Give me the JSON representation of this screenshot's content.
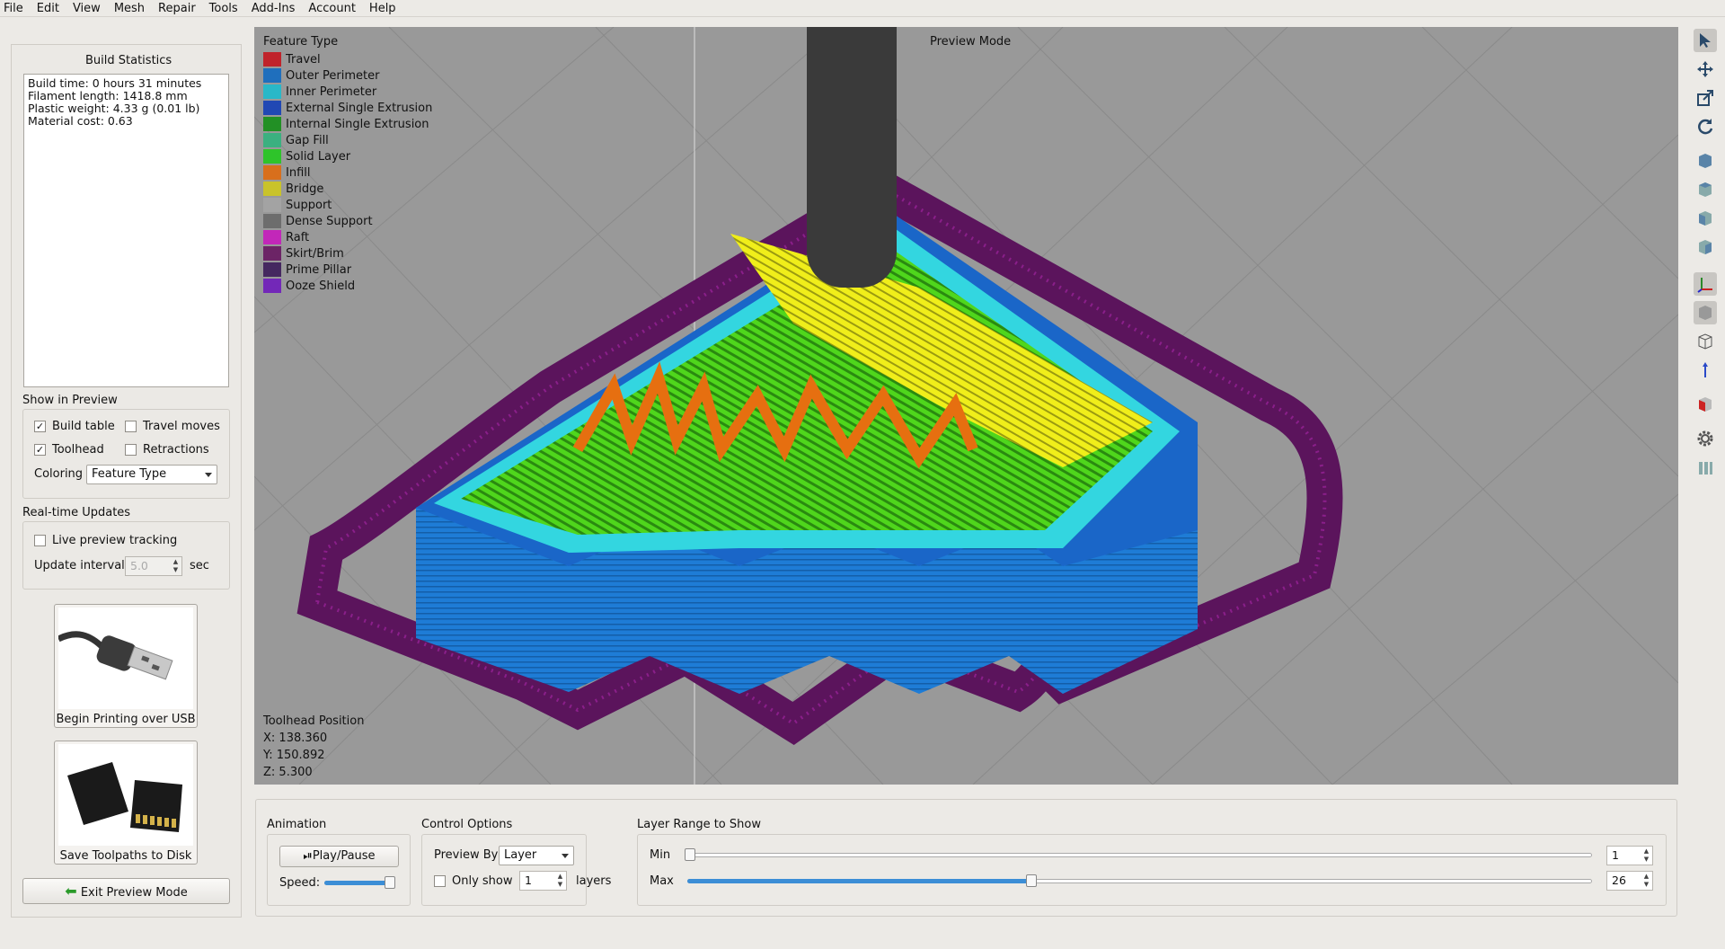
{
  "menu": [
    "File",
    "Edit",
    "View",
    "Mesh",
    "Repair",
    "Tools",
    "Add-Ins",
    "Account",
    "Help"
  ],
  "left": {
    "stats_title": "Build Statistics",
    "stats_lines": [
      "Build time: 0 hours 31 minutes",
      "Filament length: 1418.8 mm",
      "Plastic weight: 4.33 g (0.01 lb)",
      "Material cost: 0.63"
    ],
    "show_title": "Show in Preview",
    "build_table": "Build table",
    "travel_moves": "Travel moves",
    "toolhead": "Toolhead",
    "retractions": "Retractions",
    "coloring_label": "Coloring",
    "coloring_value": "Feature Type",
    "realtime_title": "Real-time Updates",
    "live_tracking": "Live preview tracking",
    "update_interval": "Update interval",
    "interval_value": "5.0",
    "sec": "sec",
    "usb_label": "Begin Printing over USB",
    "disk_label": "Save Toolpaths to Disk",
    "exit_label": "Exit Preview Mode"
  },
  "viewport": {
    "mode": "Preview Mode",
    "legend_title": "Feature Type",
    "legend": [
      {
        "name": "Travel",
        "color": "#c0232b"
      },
      {
        "name": "Outer Perimeter",
        "color": "#1f6fbd"
      },
      {
        "name": "Inner Perimeter",
        "color": "#29b8c8"
      },
      {
        "name": "External Single Extrusion",
        "color": "#2148b4"
      },
      {
        "name": "Internal Single Extrusion",
        "color": "#229025"
      },
      {
        "name": "Gap Fill",
        "color": "#3bb080"
      },
      {
        "name": "Solid Layer",
        "color": "#2ec42a"
      },
      {
        "name": "Infill",
        "color": "#d86f1c"
      },
      {
        "name": "Bridge",
        "color": "#c9c32a"
      },
      {
        "name": "Support",
        "color": "#a3a3a3"
      },
      {
        "name": "Dense Support",
        "color": "#6d6d6d"
      },
      {
        "name": "Raft",
        "color": "#c227b9"
      },
      {
        "name": "Skirt/Brim",
        "color": "#6c2466"
      },
      {
        "name": "Prime Pillar",
        "color": "#452860"
      },
      {
        "name": "Ooze Shield",
        "color": "#7328b8"
      }
    ],
    "toolhead_title": "Toolhead Position",
    "x": "X: 138.360",
    "y": "Y: 150.892",
    "z": "Z: 5.300"
  },
  "bottom": {
    "animation_title": "Animation",
    "play_label": "Play/Pause",
    "speed_label": "Speed:",
    "control_title": "Control Options",
    "preview_by_label": "Preview By",
    "preview_by_value": "Layer",
    "only_show": "Only show",
    "only_show_value": "1",
    "layers": "layers",
    "range_title": "Layer Range to Show",
    "min_label": "Min",
    "max_label": "Max",
    "min_value": "1",
    "max_value": "26",
    "max_fraction": 0.38
  }
}
